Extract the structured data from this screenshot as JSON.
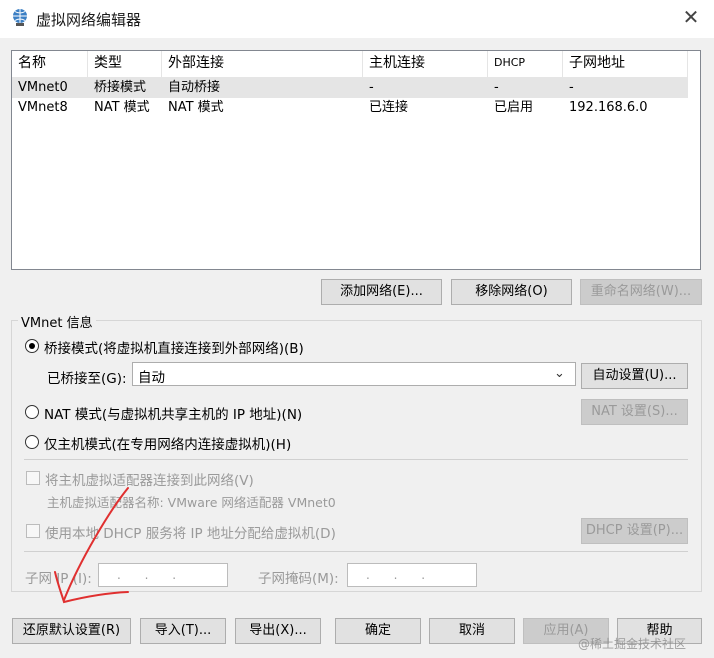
{
  "window": {
    "title": "虚拟网络编辑器",
    "close_icon": "close-icon",
    "app_icon": "network-editor-icon"
  },
  "table": {
    "columns": [
      "名称",
      "类型",
      "外部连接",
      "主机连接",
      "DHCP",
      "子网地址"
    ],
    "rows": [
      [
        "VMnet0",
        "桥接模式",
        "自动桥接",
        "-",
        "-",
        "-"
      ],
      [
        "VMnet8",
        "NAT 模式",
        "NAT 模式",
        "已连接",
        "已启用",
        "192.168.6.0"
      ]
    ]
  },
  "list_buttons": {
    "add": "添加网络(E)...",
    "remove": "移除网络(O)",
    "rename": "重命名网络(W)..."
  },
  "vmnet_info": {
    "group_label": "VMnet 信息",
    "bridged_label": "桥接模式(将虚拟机直接连接到外部网络)(B)",
    "bridged_to_label": "已桥接至(G):",
    "bridged_to_value": "自动",
    "auto_settings": "自动设置(U)...",
    "nat_label": "NAT 模式(与虚拟机共享主机的 IP 地址)(N)",
    "nat_settings": "NAT 设置(S)...",
    "hostonly_label": "仅主机模式(在专用网络内连接虚拟机)(H)",
    "connect_adapter_label": "将主机虚拟适配器连接到此网络(V)",
    "adapter_name_label": "主机虚拟适配器名称: VMware 网络适配器 VMnet0",
    "dhcp_label": "使用本地 DHCP 服务将 IP 地址分配给虚拟机(D)",
    "dhcp_settings": "DHCP 设置(P)...",
    "subnet_ip_label": "子网 IP (I):",
    "subnet_ip_value": ". . .",
    "subnet_mask_label": "子网掩码(M):",
    "subnet_mask_value": ". . .",
    "selected_mode": "bridged"
  },
  "bottom_buttons": {
    "restore": "还原默认设置(R)",
    "import": "导入(T)...",
    "export": "导出(X)...",
    "ok": "确定",
    "cancel": "取消",
    "apply": "应用(A)",
    "help": "帮助"
  },
  "watermark": "@稀土掘金技术社区",
  "colors": {
    "annotation": "#e03030",
    "disabled_text": "#9a9a9a",
    "selected_row": "#e5e5e5"
  }
}
